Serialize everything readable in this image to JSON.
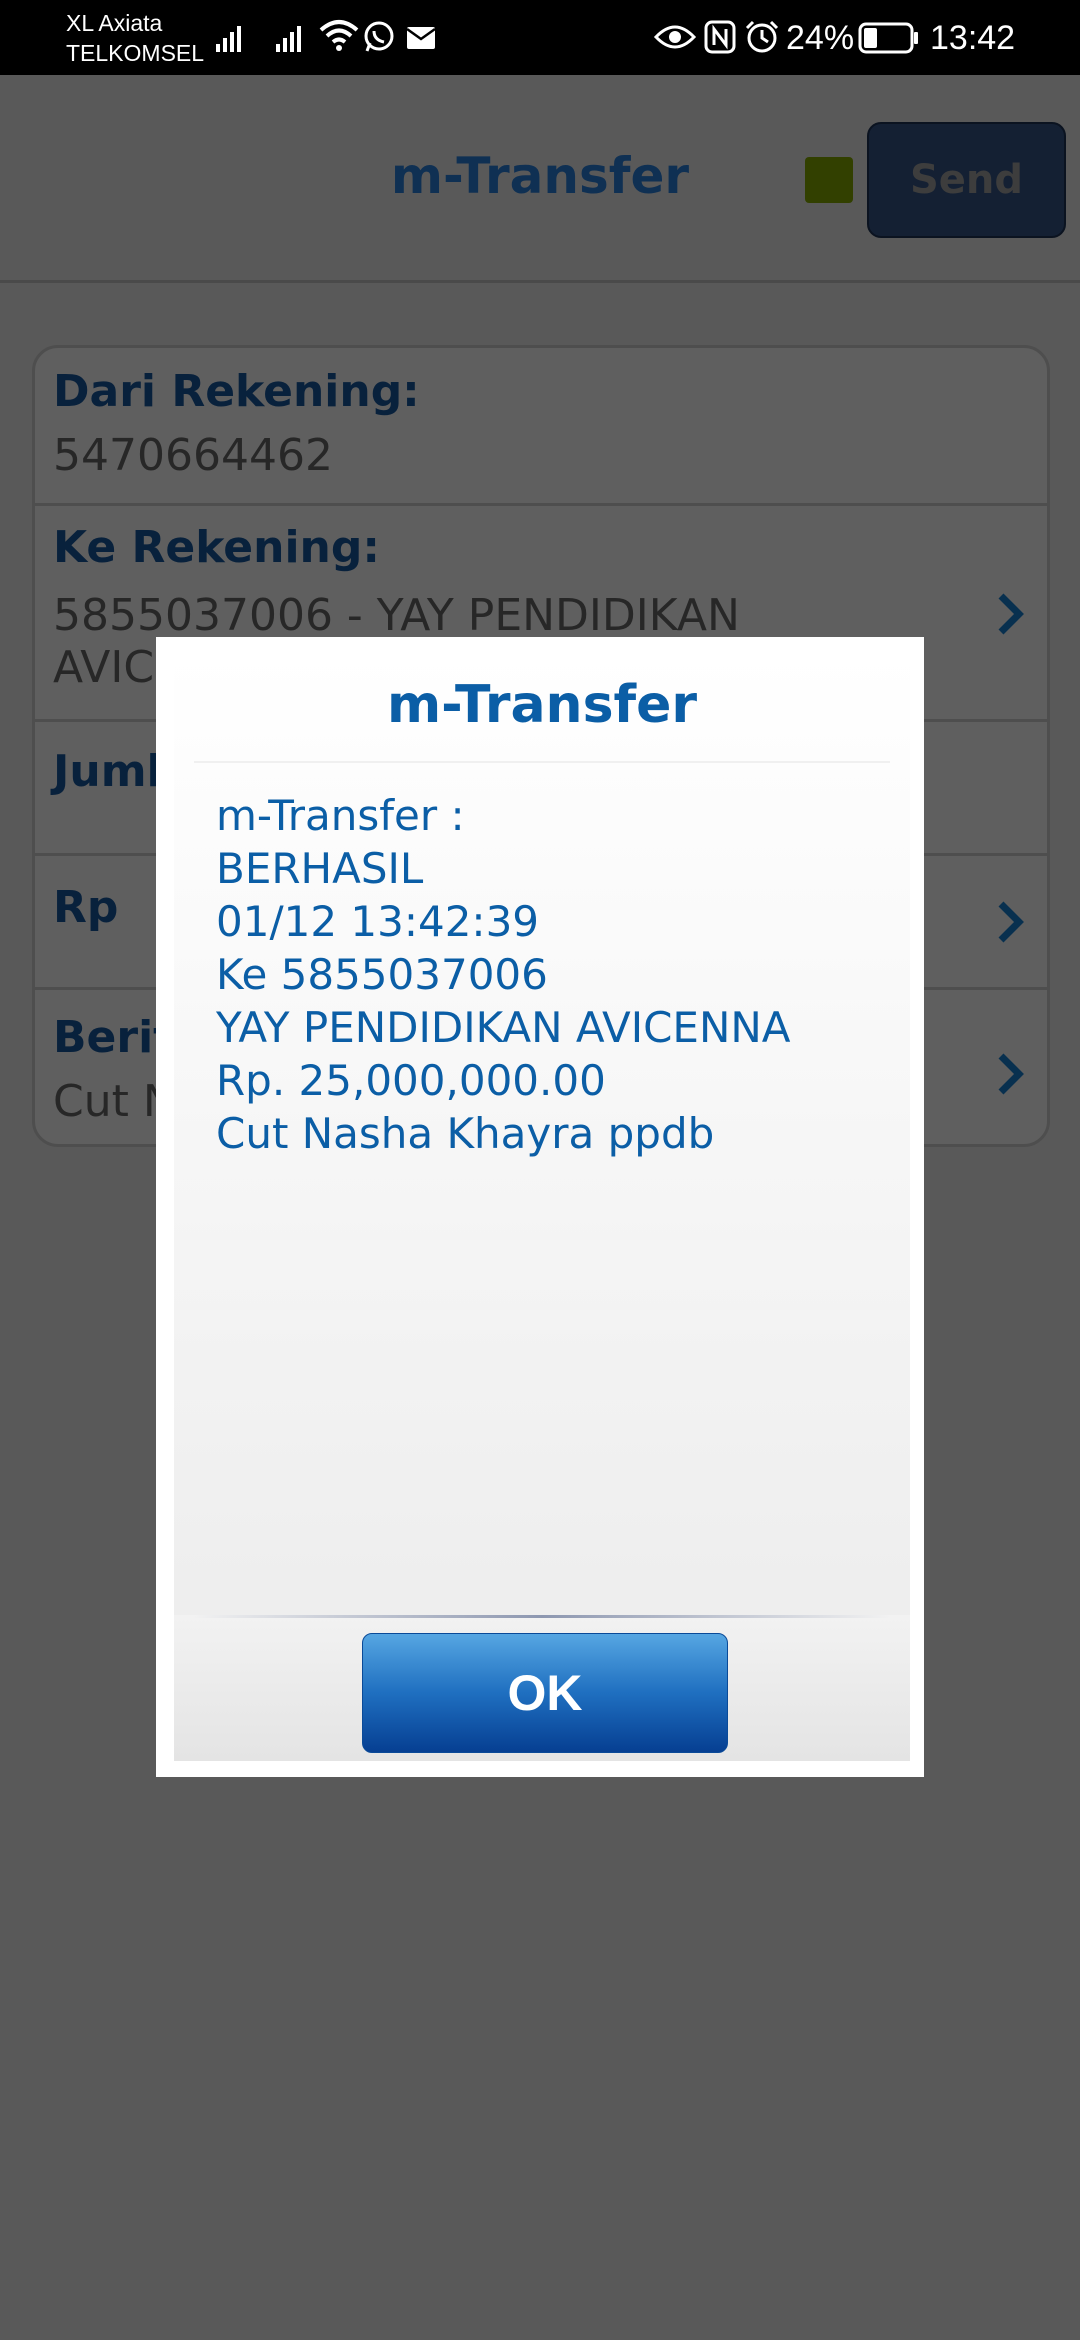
{
  "status_bar": {
    "carrier_1": "XL Axiata",
    "carrier_2": "TELKOMSEL",
    "battery": "24%",
    "time": "13:42"
  },
  "header": {
    "title": "m-Transfer",
    "send_label": "Send",
    "indicator_color": "#324000"
  },
  "form": {
    "from_label": "Dari Rekening:",
    "from_value": "5470664462",
    "to_label": "Ke Rekening:",
    "to_value_line1": "5855037006 - YAY PENDIDIKAN",
    "to_value_line2": "AVIC",
    "amount_label": "Juml",
    "currency_label": "Rp",
    "message_label": "Berit",
    "message_value": "Cut N"
  },
  "dialog": {
    "title": "m-Transfer",
    "lines": [
      "m-Transfer :",
      "BERHASIL",
      "01/12 13:42:39",
      "Ke 5855037006",
      "YAY PENDIDIKAN AVICENNA",
      "Rp. 25,000,000.00",
      "Cut Nasha Khayra ppdb"
    ],
    "ok_label": "OK"
  },
  "colors": {
    "dialog_text": "#0b5ea6",
    "ok_button": "#1f6fc0"
  }
}
